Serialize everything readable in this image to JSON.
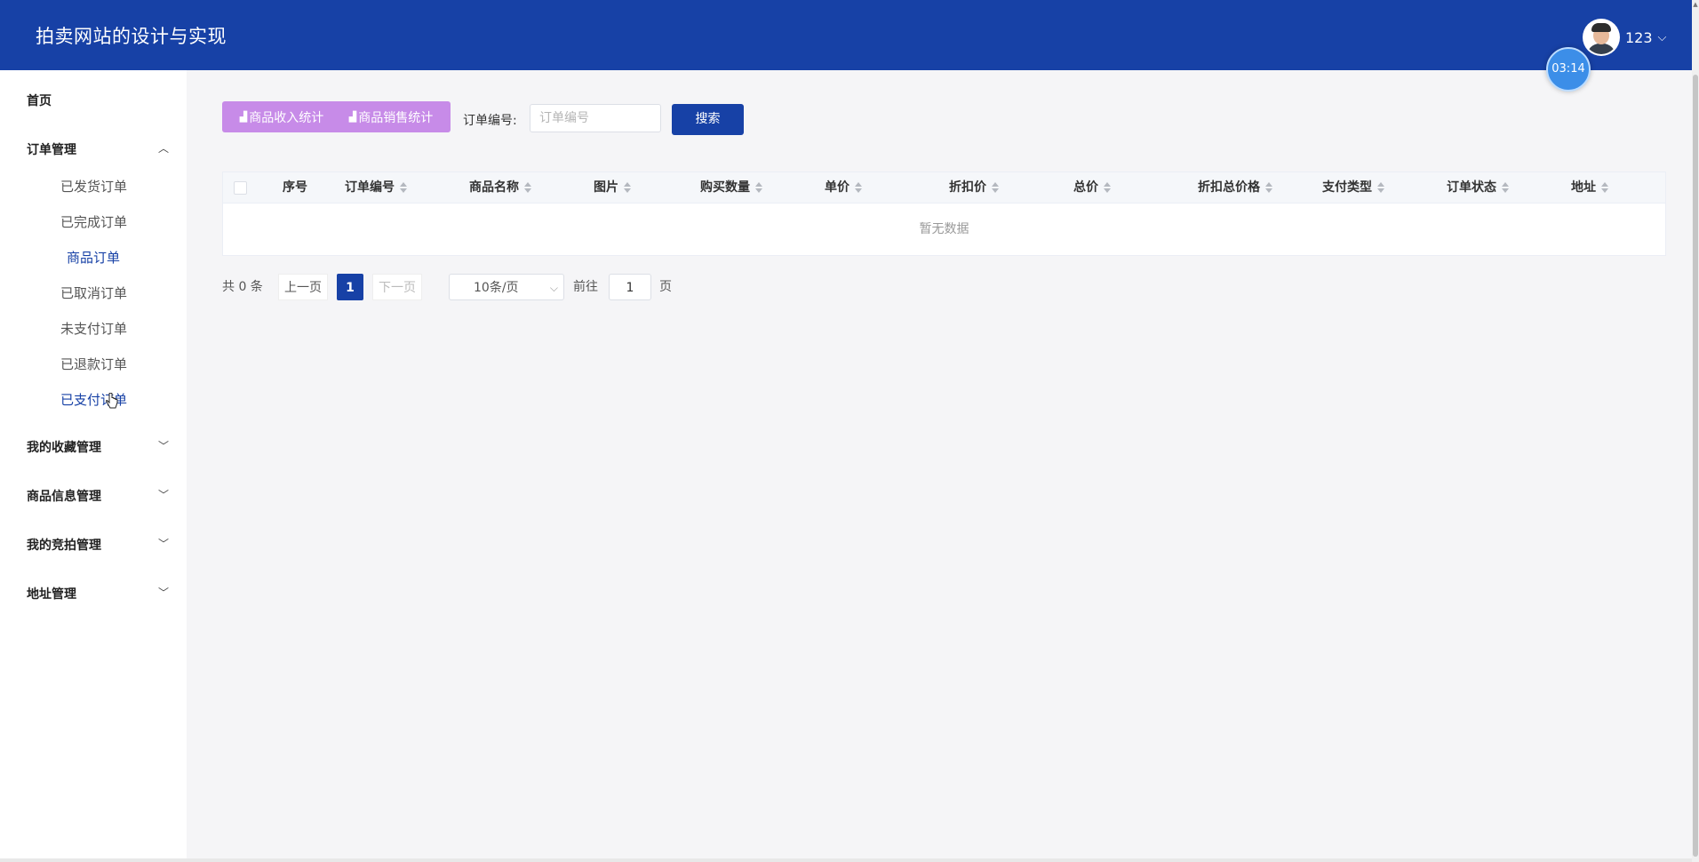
{
  "header": {
    "title": "拍卖网站的设计与实现",
    "user_name": "123",
    "timer": "03:14"
  },
  "sidebar": {
    "items": [
      {
        "label": "首页",
        "type": "top"
      },
      {
        "label": "订单管理",
        "type": "group",
        "expanded": true
      },
      {
        "label": "已发货订单",
        "type": "sub"
      },
      {
        "label": "已完成订单",
        "type": "sub"
      },
      {
        "label": "商品订单",
        "type": "sub",
        "active": true
      },
      {
        "label": "已取消订单",
        "type": "sub"
      },
      {
        "label": "未支付订单",
        "type": "sub"
      },
      {
        "label": "已退款订单",
        "type": "sub"
      },
      {
        "label": "已支付订单",
        "type": "sub",
        "hover": true
      },
      {
        "label": "我的收藏管理",
        "type": "group"
      },
      {
        "label": "商品信息管理",
        "type": "group"
      },
      {
        "label": "我的竞拍管理",
        "type": "group"
      },
      {
        "label": "地址管理",
        "type": "group"
      }
    ]
  },
  "toolbar": {
    "income_stats": "商品收入统计",
    "sales_stats": "商品销售统计",
    "order_no_label": "订单编号:",
    "order_no_placeholder": "订单编号",
    "search": "搜索"
  },
  "table": {
    "columns": [
      "序号",
      "订单编号",
      "商品名称",
      "图片",
      "购买数量",
      "单价",
      "折扣价",
      "总价",
      "折扣总价格",
      "支付类型",
      "订单状态",
      "地址"
    ],
    "empty_text": "暂无数据"
  },
  "pagination": {
    "total": "共 0 条",
    "prev": "上一页",
    "current": "1",
    "next": "下一页",
    "page_size": "10条/页",
    "goto": "前往",
    "jump_value": "1",
    "page_suffix": "页"
  },
  "colors": {
    "primary": "#1741a6",
    "stat_button": "#c78be8"
  }
}
